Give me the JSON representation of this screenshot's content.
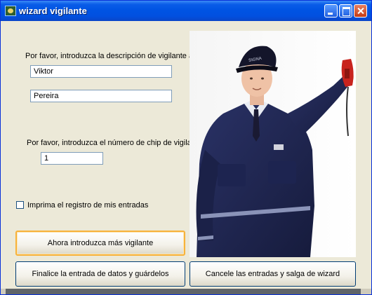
{
  "window": {
    "title": "wizard vigilante",
    "icon": "wizard-app-icon",
    "controls": [
      "minimize-icon",
      "maximize-icon",
      "close-icon"
    ]
  },
  "description": {
    "prompt": "Por favor, introduzca la descripción de vigilante aquí",
    "first_name": "Viktor",
    "last_name": "Pereira"
  },
  "chip": {
    "prompt": "Por favor, introduzca el número de chip de vigilante",
    "value": "1"
  },
  "print_log": {
    "label": "Imprima el registro de mis entradas",
    "checked": false
  },
  "buttons": {
    "more": "Ahora introduzca más vigilante",
    "finish": "Finalice la entrada de datos y guárdelos",
    "cancel": "Cancele las entradas y salga de wizard"
  },
  "photo": {
    "subject": "security-guard-photo",
    "cap_text": "SIGNA"
  }
}
